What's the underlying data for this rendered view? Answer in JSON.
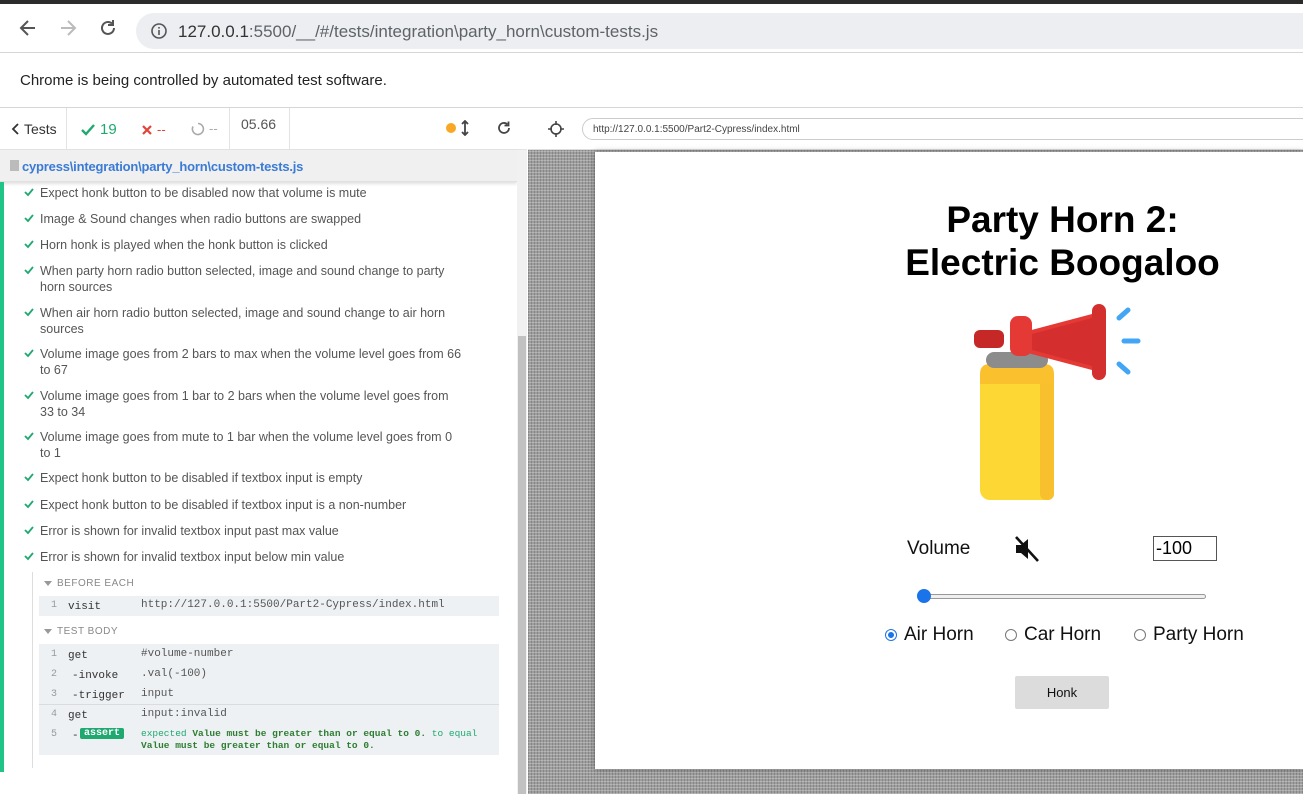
{
  "browser": {
    "url_host": "127.0.0.1",
    "url_rest": ":5500/__/#/tests/integration\\party_horn\\custom-tests.js",
    "banner": "Chrome is being controlled by automated test software."
  },
  "reporter": {
    "tests_label": "Tests",
    "passed": "19",
    "failed": "--",
    "pending": "--",
    "duration": "05.66",
    "spec_path": "cypress\\integration\\party_horn\\custom-tests.js",
    "tests": [
      "Expect honk button to be disabled now that volume is mute",
      "Image & Sound changes when radio buttons are swapped",
      "Horn honk is played when the honk button is clicked",
      "When party horn radio button selected, image and sound change to party horn sources",
      "When air horn radio button selected, image and sound change to air horn sources",
      "Volume image goes from 2 bars to max when the volume level goes from 66 to 67",
      "Volume image goes from 1 bar to 2 bars when the volume level goes from 33 to 34",
      "Volume image goes from mute to 1 bar when the volume level goes from 0 to 1",
      "Expect honk button to be disabled if textbox input is empty",
      "Expect honk button to be disabled if textbox input is a non-number",
      "Error is shown for invalid textbox input past max value",
      "Error is shown for invalid textbox input below min value"
    ],
    "before_each": {
      "title": "BEFORE EACH",
      "rows": [
        {
          "n": "1",
          "cmd": "visit",
          "val": "http://127.0.0.1:5500/Part2-Cypress/index.html"
        }
      ]
    },
    "test_body": {
      "title": "TEST BODY",
      "rows": [
        {
          "n": "1",
          "cmd": "get",
          "val": "#volume-number"
        },
        {
          "n": "2",
          "cmd": "-invoke",
          "val": ".val(-100)"
        },
        {
          "n": "3",
          "cmd": "-trigger",
          "val": "input"
        },
        {
          "n": "4",
          "cmd": "get",
          "val": "input:invalid"
        },
        {
          "n": "5",
          "cmd": "-",
          "badge": "assert",
          "expected": "expected",
          "msg1": "Value must be greater than or equal to 0.",
          "to_equal": "to equal",
          "msg2": "Value must be greater than or equal to 0."
        }
      ]
    }
  },
  "aut": {
    "url": "http://127.0.0.1:5500/Part2-Cypress/index.html",
    "title_line1": "Party Horn 2:",
    "title_line2": "Electric Boogaloo",
    "volume_label": "Volume",
    "volume_value": "-100",
    "slider_value": 0,
    "radios": [
      {
        "label": "Air Horn",
        "checked": true
      },
      {
        "label": "Car Horn",
        "checked": false
      },
      {
        "label": "Party Horn",
        "checked": false
      }
    ],
    "honk_label": "Honk"
  }
}
